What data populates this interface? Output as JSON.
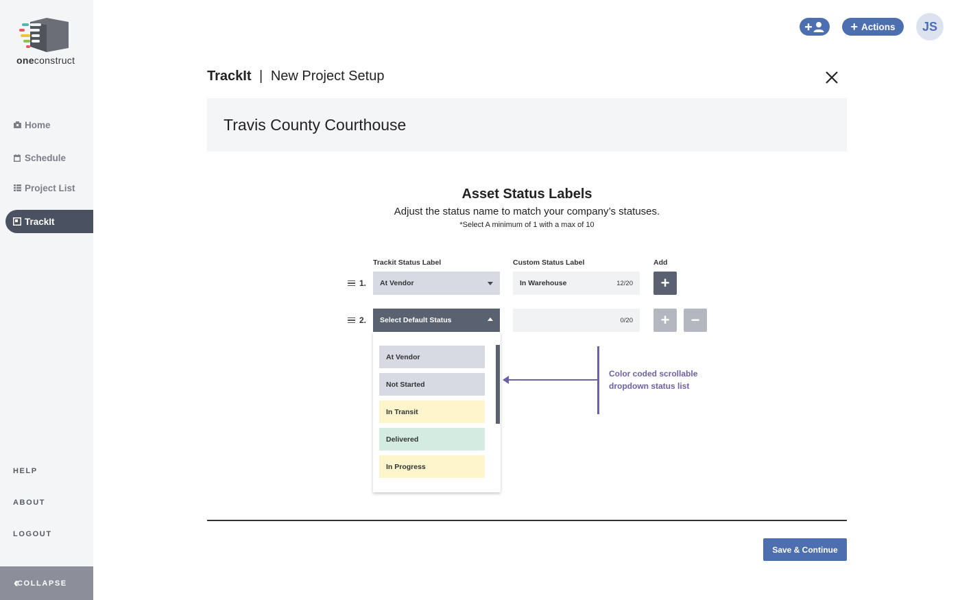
{
  "brand": {
    "logo_text_bold": "one",
    "logo_text_rest": "construct"
  },
  "sidebar": {
    "items": [
      {
        "label": "Home",
        "icon": "home-icon"
      },
      {
        "label": "Schedule",
        "icon": "calendar-icon"
      },
      {
        "label": "Project List",
        "icon": "list-icon"
      },
      {
        "label": "TrackIt",
        "icon": "trackit-icon",
        "active": true
      }
    ],
    "links": [
      "HELP",
      "ABOUT",
      "LOGOUT"
    ],
    "collapse_label": "COLLAPSE"
  },
  "topbar": {
    "actions_label": "Actions",
    "avatar_initials": "JS"
  },
  "header": {
    "app_name": "TrackIt",
    "separator": "|",
    "page": "New Project Setup"
  },
  "project": {
    "name": "Travis County Courthouse"
  },
  "section": {
    "title": "Asset Status Labels",
    "subtitle": "Adjust the status name to match your company’s statuses.",
    "note": "*Select A minimum of 1 with a max of 10"
  },
  "columns": {
    "trackit_label": "Trackit Status Label",
    "custom_label": "Custom Status Label",
    "add": "Add"
  },
  "rows": [
    {
      "number": "1.",
      "status": "At Vendor",
      "custom_value": "In Warehouse",
      "count": "12/20"
    },
    {
      "number": "2.",
      "status": "Select Default Status",
      "custom_value": "",
      "count": "0/20"
    }
  ],
  "dropdown": {
    "options": [
      {
        "label": "At Vendor",
        "color": "#d8dae3"
      },
      {
        "label": "Not Started",
        "color": "#d8dae3"
      },
      {
        "label": "In Transit",
        "color": "#fdf6cc"
      },
      {
        "label": "Delivered",
        "color": "#d3ebe1"
      },
      {
        "label": "In Progress",
        "color": "#fdf6cc"
      }
    ]
  },
  "annotation": {
    "line1": "Color coded scrollable",
    "line2": "dropdown status list",
    "color": "#6f5fa6"
  },
  "footer": {
    "save_label": "Save & Continue"
  },
  "colors": {
    "accent": "#4d6fb0",
    "nav_active": "#4a5160",
    "sidebar_bg": "#f4f5f7"
  }
}
